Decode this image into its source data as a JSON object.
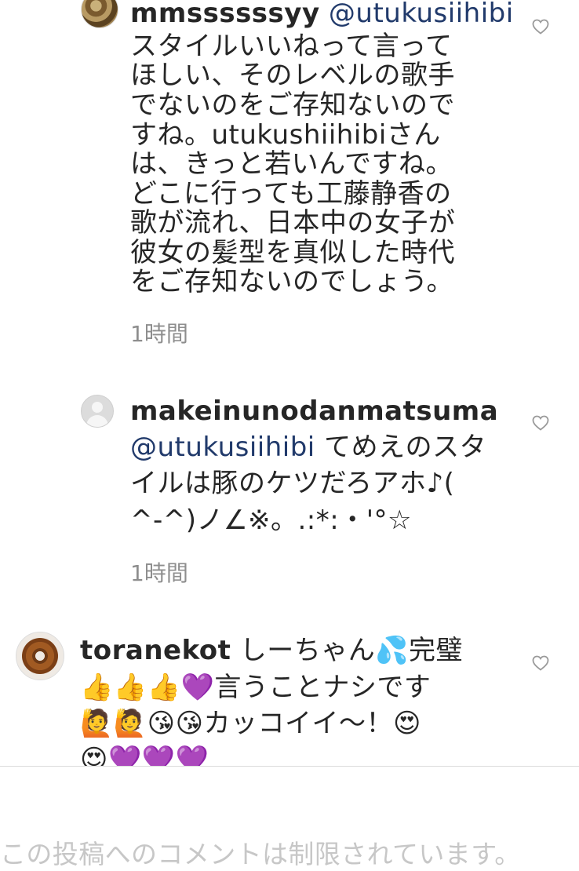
{
  "comments": [
    {
      "username": "mmssssssyy",
      "mention": "@utukusiihibi",
      "lines": [
        "スタイルいいねって言って",
        "ほしい、そのレベルの歌手",
        "でないのをご存知ないので",
        "すね。utukushiihibiさん",
        "は、きっと若いんですね。",
        "どこに行っても工藤静香の",
        "歌が流れ、日本中の女子が",
        "彼女の髪型を真似した時代",
        "をご存知ないのでしょう。"
      ],
      "time": "1時間"
    },
    {
      "username": "makeinunodanmatsuma",
      "mention": "@utukusiihibi",
      "line1_rest": " てめえのスタ",
      "lines": [
        "イルは豚のケツだろアホ♪(",
        "^-^)ノ∠※。.:*:・'°☆"
      ],
      "time": "1時間"
    },
    {
      "username": "toranekot",
      "line1_rest": " しーちゃん💦完璧",
      "lines": [
        "👍👍👍💜言うことナシです",
        "🙋🙋😘😘カッコイイ〜！😍",
        "😍💜💜💜"
      ]
    }
  ],
  "footer": {
    "restricted_text": "この投稿へのコメントは制限されています。"
  },
  "icons": {
    "like": "heart-outline-icon"
  },
  "colors": {
    "mention": "#213a6b",
    "timestamp": "#8e8e8e",
    "footer_text": "#c7c7c7",
    "heart": "#9a9a9a"
  }
}
